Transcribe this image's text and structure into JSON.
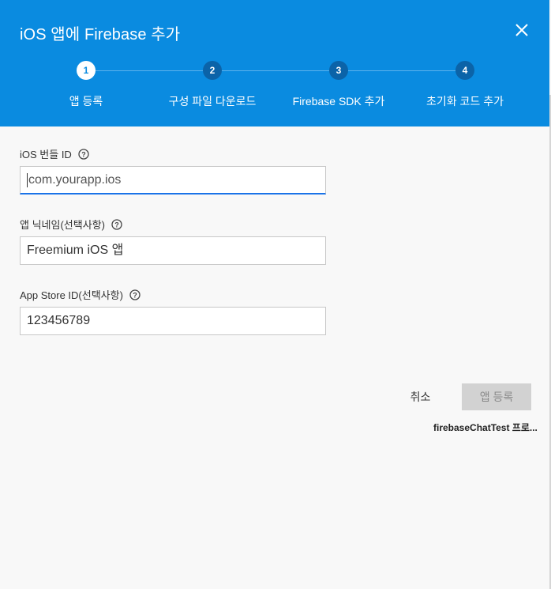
{
  "dialog": {
    "title": "iOS 앱에 Firebase 추가",
    "close_icon": "close-icon"
  },
  "steps": [
    {
      "number": "1",
      "label": "앱 등록",
      "active": true
    },
    {
      "number": "2",
      "label": "구성 파일 다운로드",
      "active": false
    },
    {
      "number": "3",
      "label": "Firebase SDK 추가",
      "active": false
    },
    {
      "number": "4",
      "label": "초기화 코드 추가",
      "active": false
    }
  ],
  "form": {
    "bundle_id": {
      "label": "iOS 번들 ID",
      "placeholder": "com.yourapp.ios",
      "value": ""
    },
    "nickname": {
      "label": "앱 닉네임(선택사항)",
      "value": "Freemium iOS 앱"
    },
    "app_store_id": {
      "label": "App Store ID(선택사항)",
      "value": "123456789"
    }
  },
  "actions": {
    "cancel_label": "취소",
    "register_label": "앱 등록"
  },
  "project_name": "firebaseChatTest 프로...",
  "colors": {
    "header": "#0a8be0",
    "active_step": "#ffffff",
    "inactive_step": "#0b63a8",
    "focus_underline": "#1a73e8",
    "disabled_button": "#d2d2d2"
  }
}
